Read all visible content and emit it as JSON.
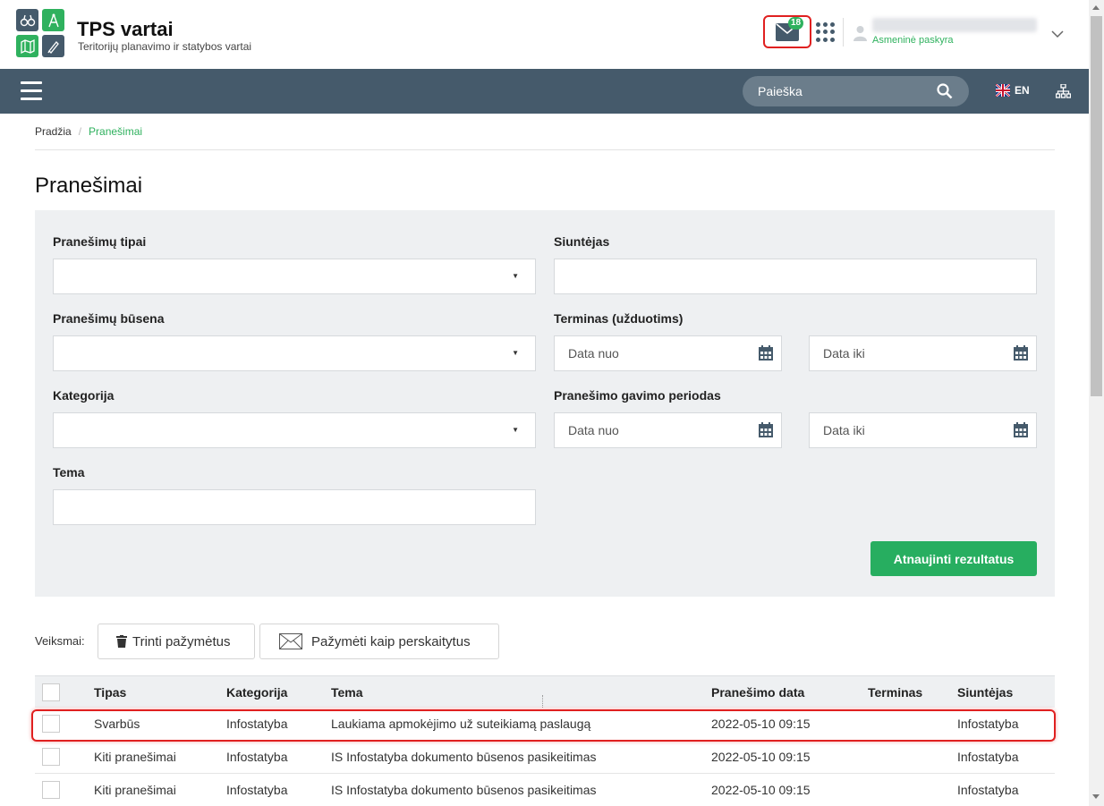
{
  "app": {
    "title": "TPS vartai",
    "subtitle": "Teritorijų planavimo ir statybos vartai"
  },
  "header": {
    "mail_badge": "18",
    "user_link": "Asmeninė paskyra"
  },
  "nav": {
    "search_placeholder": "Paieška",
    "lang_code": "EN"
  },
  "breadcrumb": {
    "home": "Pradžia",
    "current": "Pranešimai"
  },
  "page": {
    "title": "Pranešimai"
  },
  "filters": {
    "types_label": "Pranešimų tipai",
    "sender_label": "Siuntėjas",
    "status_label": "Pranešimų būsena",
    "deadline_label": "Terminas (užduotims)",
    "category_label": "Kategorija",
    "received_label": "Pranešimo gavimo periodas",
    "topic_label": "Tema",
    "date_from": "Data nuo",
    "date_to": "Data iki",
    "submit_label": "Atnaujinti rezultatus"
  },
  "actions": {
    "label": "Veiksmai:",
    "delete_label": "Trinti pažymėtus",
    "mark_read_label": "Pažymėti kaip perskaitytus"
  },
  "table": {
    "columns": {
      "type": "Tipas",
      "category": "Kategorija",
      "topic": "Tema",
      "date": "Pranešimo data",
      "deadline": "Terminas",
      "sender": "Siuntėjas"
    },
    "rows": [
      {
        "type": "Svarbūs",
        "category": "Infostatyba",
        "topic": "Laukiama apmokėjimo už suteikiamą paslaugą",
        "date": "2022-05-10 09:15",
        "deadline": "",
        "sender": "Infostatyba"
      },
      {
        "type": "Kiti pranešimai",
        "category": "Infostatyba",
        "topic": "IS Infostatyba dokumento būsenos pasikeitimas",
        "date": "2022-05-10 09:15",
        "deadline": "",
        "sender": "Infostatyba"
      },
      {
        "type": "Kiti pranešimai",
        "category": "Infostatyba",
        "topic": "IS Infostatyba dokumento būsenos pasikeitimas",
        "date": "2022-05-10 09:15",
        "deadline": "",
        "sender": "Infostatyba"
      }
    ]
  },
  "colors": {
    "brand_dark": "#455a6b",
    "brand_green": "#2fb15e",
    "button_green": "#27ae60",
    "highlight_red": "#e02020"
  }
}
